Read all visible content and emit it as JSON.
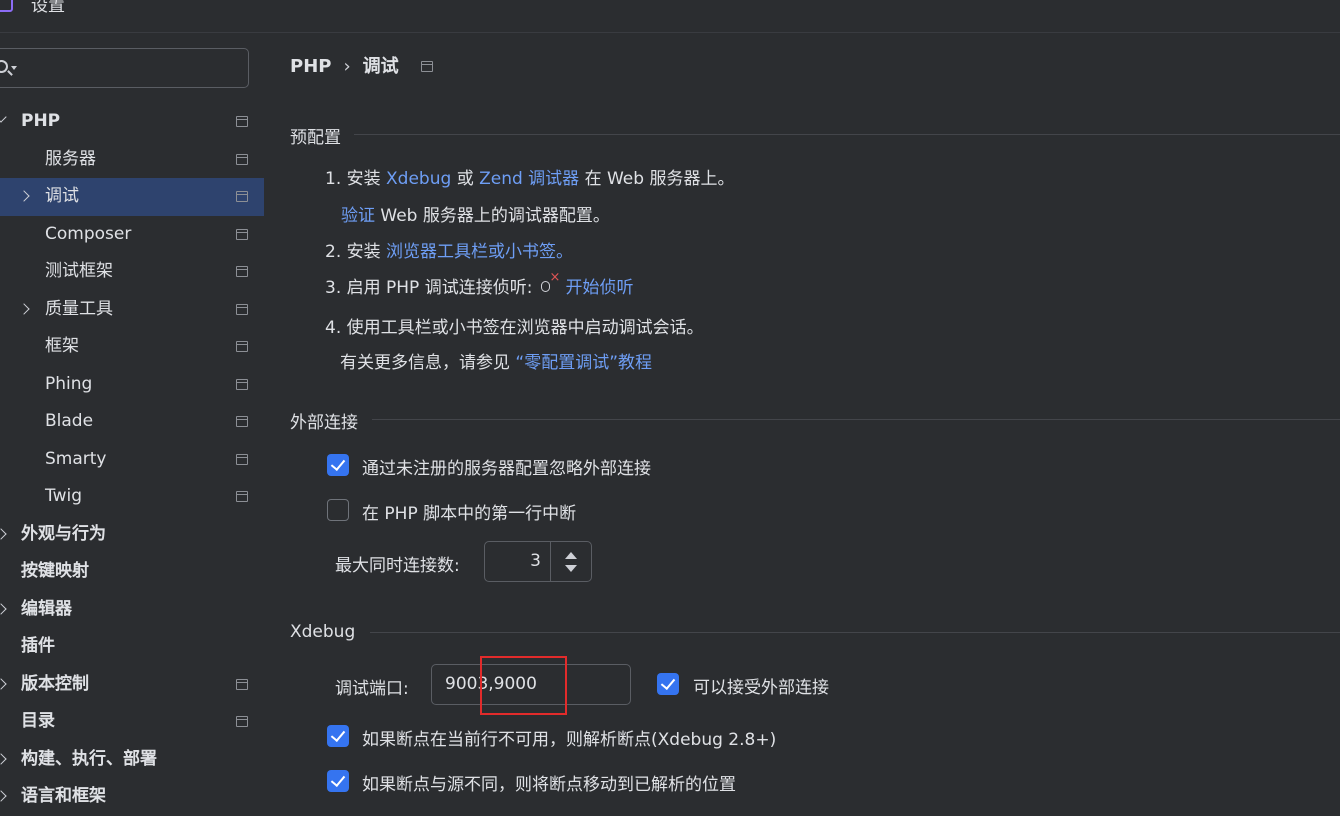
{
  "window": {
    "title": "设置"
  },
  "search": {
    "placeholder": ""
  },
  "sidebar": {
    "items": [
      {
        "label": "PHP",
        "level": 0,
        "bold": true,
        "chevron": "down",
        "icon": true
      },
      {
        "label": "服务器",
        "level": 1,
        "chevron": "",
        "icon": true
      },
      {
        "label": "调试",
        "level": 1,
        "chevron": "right",
        "icon": true,
        "selected": true
      },
      {
        "label": "Composer",
        "level": 1,
        "chevron": "",
        "icon": true
      },
      {
        "label": "测试框架",
        "level": 1,
        "chevron": "",
        "icon": true
      },
      {
        "label": "质量工具",
        "level": 1,
        "chevron": "right",
        "icon": true
      },
      {
        "label": "框架",
        "level": 1,
        "chevron": "",
        "icon": true
      },
      {
        "label": "Phing",
        "level": 1,
        "chevron": "",
        "icon": true
      },
      {
        "label": "Blade",
        "level": 1,
        "chevron": "",
        "icon": true
      },
      {
        "label": "Smarty",
        "level": 1,
        "chevron": "",
        "icon": true
      },
      {
        "label": "Twig",
        "level": 1,
        "chevron": "",
        "icon": true
      },
      {
        "label": "外观与行为",
        "level": 0,
        "bold": true,
        "chevron": "right",
        "icon": false
      },
      {
        "label": "按键映射",
        "level": 0,
        "bold": true,
        "chevron": "",
        "icon": false
      },
      {
        "label": "编辑器",
        "level": 0,
        "bold": true,
        "chevron": "right",
        "icon": false
      },
      {
        "label": "插件",
        "level": 0,
        "bold": true,
        "chevron": "",
        "icon": false
      },
      {
        "label": "版本控制",
        "level": 0,
        "bold": true,
        "chevron": "right",
        "icon": true
      },
      {
        "label": "目录",
        "level": 0,
        "bold": true,
        "chevron": "",
        "icon": true
      },
      {
        "label": "构建、执行、部署",
        "level": 0,
        "bold": true,
        "chevron": "right",
        "icon": false
      },
      {
        "label": "语言和框架",
        "level": 0,
        "bold": true,
        "chevron": "right",
        "icon": false
      }
    ]
  },
  "breadcrumb": {
    "parent": "PHP",
    "separator": "›",
    "current": "调试"
  },
  "preconfig": {
    "title": "预配置",
    "step1_prefix": "1. 安装 ",
    "step1_link_xdebug": "Xdebug",
    "step1_or": " 或 ",
    "step1_link_zend": "Zend 调试器",
    "step1_suffix": " 在 Web 服务器上。",
    "verify_link": "验证",
    "verify_suffix": " Web 服务器上的调试器配置。",
    "step2_prefix": "2. 安装 ",
    "step2_link": "浏览器工具栏或小书签。",
    "step3_prefix": "3. 启用 PHP 调试连接侦听:",
    "step3_link": "开始侦听",
    "step4": "4. 使用工具栏或小书签在浏览器中启动调试会话。",
    "more_prefix": "有关更多信息，请参见 ",
    "more_link": "“零配置调试”教程"
  },
  "external": {
    "title": "外部连接",
    "ignore_unregistered": {
      "label": "通过未注册的服务器配置忽略外部连接",
      "checked": true
    },
    "break_first_line": {
      "label": "在 PHP 脚本中的第一行中断",
      "checked": false
    },
    "max_connections_label": "最大同时连接数:",
    "max_connections_value": "3"
  },
  "xdebug": {
    "title": "Xdebug",
    "port_label": "调试端口:",
    "port_value": "9003,9000",
    "accept_external": {
      "label": "可以接受外部连接",
      "checked": true
    },
    "resolve_breakpoint": {
      "label": "如果断点在当前行不可用，则解析断点(Xdebug 2.8+)",
      "checked": true
    },
    "move_breakpoint": {
      "label": "如果断点与源不同，则将断点移动到已解析的位置",
      "checked": true
    }
  },
  "colors": {
    "accent": "#3574f0",
    "link": "#6e9ef5",
    "selection": "#2e436e",
    "highlight": "#e22b2b"
  }
}
